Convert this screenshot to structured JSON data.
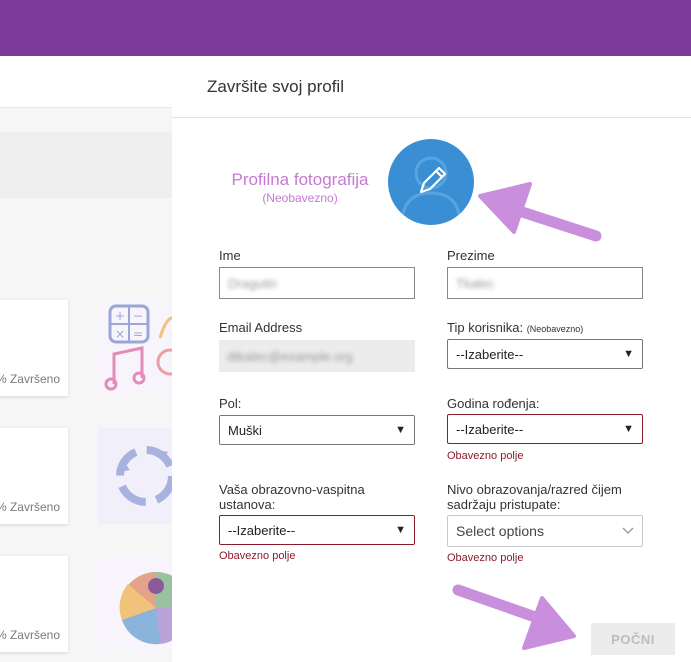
{
  "modal": {
    "title": "Završite svoj profil",
    "photo": {
      "title": "Profilna fotografija",
      "subtitle": "(Neobavezno)"
    },
    "fields": {
      "first_name": {
        "label": "Ime"
      },
      "last_name": {
        "label": "Prezime"
      },
      "email": {
        "label": "Email Address"
      },
      "user_type": {
        "label": "Tip korisnika:",
        "label_note": "(Neobavezno)",
        "value": "--Izaberite--"
      },
      "gender": {
        "label": "Pol:",
        "value": "Muški"
      },
      "birth_year": {
        "label": "Godina rođenja:",
        "value": "--Izaberite--",
        "error": "Obavezno polje"
      },
      "institution": {
        "label_line1": "Vaša obrazovno-vaspitna",
        "label_line2": "ustanova:",
        "value": "--Izaberite--",
        "error": "Obavezno polje"
      },
      "education_level": {
        "label_line1": "Nivo obrazovanja/razred čijem",
        "label_line2": "sadržaju pristupate:",
        "value": "Select options",
        "error": "Obavezno polje"
      }
    },
    "start_button": "POČNI"
  },
  "background": {
    "cards": [
      {
        "label": "% Završeno"
      },
      {
        "label": "% Završeno"
      },
      {
        "label": "% Završeno"
      }
    ]
  },
  "colors": {
    "topbar": "#7d3a98",
    "accent_label": "#c57ad3",
    "avatar": "#3a8fd4",
    "error": "#8b1c2b",
    "annotation_arrow": "#c98fdc"
  }
}
